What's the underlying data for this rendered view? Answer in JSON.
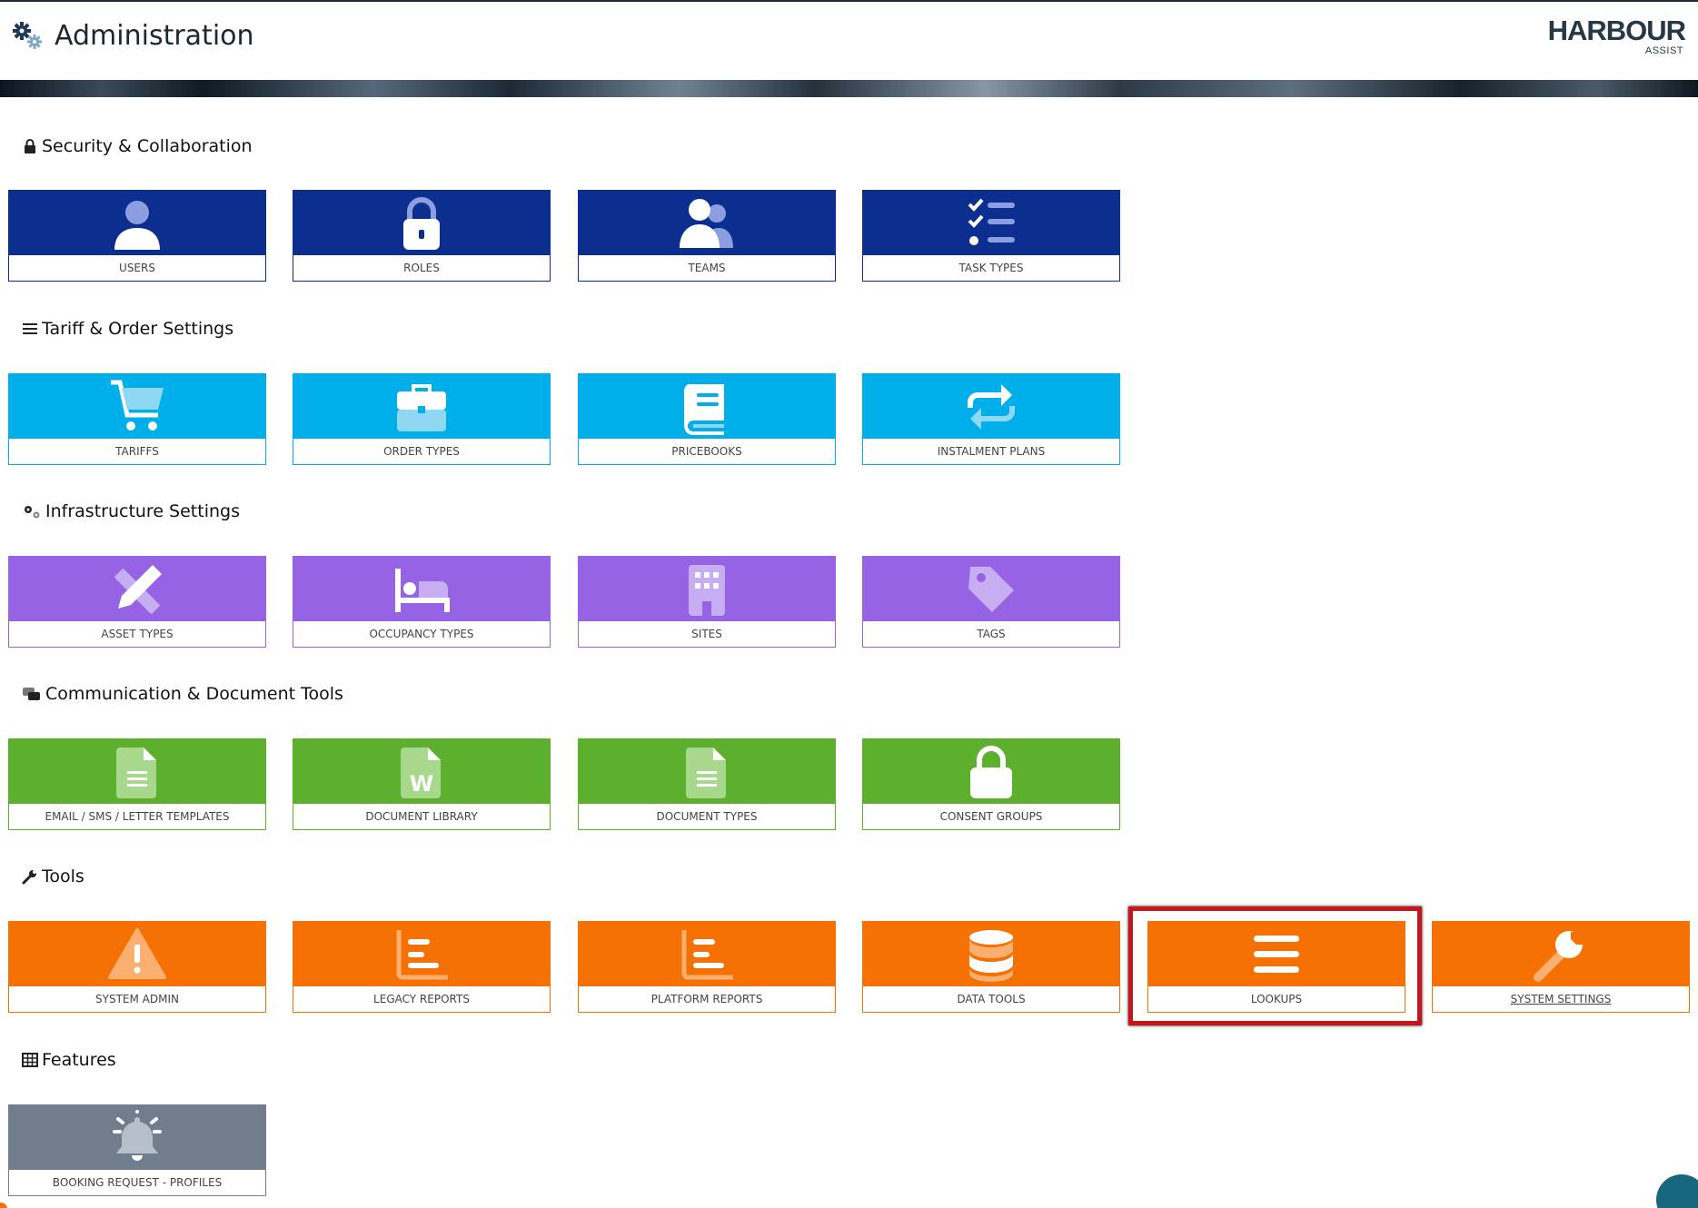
{
  "header": {
    "title": "Administration",
    "logo_brand": "HARBOUR",
    "logo_sub": "ASSIST"
  },
  "colors": {
    "security": "#0b2e8f",
    "tariff": "#00aeea",
    "infrastructure": "#9563e3",
    "communication": "#5daf2e",
    "tools": "#f57103",
    "features": "#6f7d8c",
    "highlight": "#c4161c"
  },
  "sections": [
    {
      "title": "Security & Collaboration",
      "icon": "lock-icon",
      "tiles": [
        {
          "label": "USERS",
          "icon": "user-icon"
        },
        {
          "label": "ROLES",
          "icon": "padlock-icon"
        },
        {
          "label": "TEAMS",
          "icon": "users-icon"
        },
        {
          "label": "TASK TYPES",
          "icon": "checklist-icon"
        }
      ]
    },
    {
      "title": "Tariff & Order Settings",
      "icon": "list-icon",
      "tiles": [
        {
          "label": "TARIFFS",
          "icon": "cart-icon"
        },
        {
          "label": "ORDER TYPES",
          "icon": "briefcase-icon"
        },
        {
          "label": "PRICEBOOKS",
          "icon": "book-icon"
        },
        {
          "label": "INSTALMENT PLANS",
          "icon": "repeat-icon"
        }
      ]
    },
    {
      "title": "Infrastructure Settings",
      "icon": "gears-icon",
      "tiles": [
        {
          "label": "ASSET TYPES",
          "icon": "pencil-ruler-icon"
        },
        {
          "label": "OCCUPANCY TYPES",
          "icon": "bed-icon"
        },
        {
          "label": "SITES",
          "icon": "building-icon"
        },
        {
          "label": "TAGS",
          "icon": "tag-icon"
        }
      ]
    },
    {
      "title": "Communication & Document Tools",
      "icon": "comments-icon",
      "tiles": [
        {
          "label": "EMAIL / SMS / LETTER TEMPLATES",
          "icon": "file-text-icon"
        },
        {
          "label": "DOCUMENT LIBRARY",
          "icon": "file-word-icon"
        },
        {
          "label": "DOCUMENT TYPES",
          "icon": "file-lines-icon"
        },
        {
          "label": "CONSENT GROUPS",
          "icon": "lock-closed-icon"
        }
      ]
    },
    {
      "title": "Tools",
      "icon": "wrench-icon",
      "tiles": [
        {
          "label": "SYSTEM ADMIN",
          "icon": "warning-icon"
        },
        {
          "label": "LEGACY REPORTS",
          "icon": "bar-chart-icon"
        },
        {
          "label": "PLATFORM REPORTS",
          "icon": "bar-chart-icon"
        },
        {
          "label": "DATA TOOLS",
          "icon": "database-icon"
        },
        {
          "label": "LOOKUPS",
          "icon": "bars-icon"
        },
        {
          "label": "SYSTEM SETTINGS",
          "icon": "wrench-icon"
        }
      ]
    },
    {
      "title": "Features",
      "icon": "table-icon",
      "tiles": [
        {
          "label": "BOOKING REQUEST - PROFILES",
          "icon": "bell-icon"
        }
      ]
    }
  ]
}
